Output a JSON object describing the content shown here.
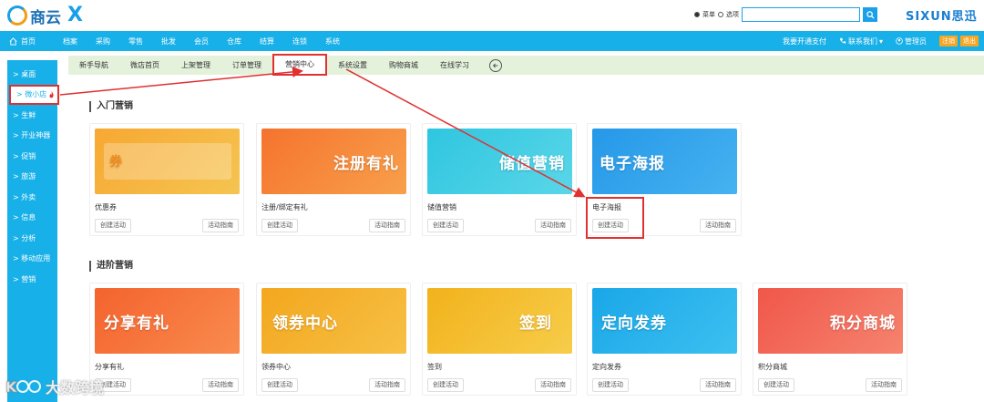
{
  "header": {
    "logo_text": "商云",
    "logo_x": "X",
    "brand": "SIXUN思迅",
    "search": {
      "option_menu": "菜单",
      "option_product": "选项",
      "value": ""
    }
  },
  "nav": {
    "items": [
      {
        "label": "首页",
        "icon": "home-icon"
      },
      {
        "label": "档案"
      },
      {
        "label": "采购"
      },
      {
        "label": "零售"
      },
      {
        "label": "批发"
      },
      {
        "label": "会员"
      },
      {
        "label": "仓库"
      },
      {
        "label": "结算"
      },
      {
        "label": "连锁"
      },
      {
        "label": "系统"
      }
    ],
    "right": {
      "pay": "我要开通支付",
      "contact": "联系我们",
      "admin": "管理员",
      "btn1": "注销",
      "btn2": "退出"
    }
  },
  "sidebar": {
    "items": [
      "> 桌面",
      "> 微小店",
      "> 生鲜",
      "> 开业神器",
      "> 促销",
      "> 旅游",
      "> 外卖",
      "> 信息",
      "> 分析",
      "> 移动应用",
      "> 营销"
    ]
  },
  "subnav": {
    "items": [
      "新手导航",
      "微店首页",
      "上架管理",
      "订单管理",
      "营销中心",
      "系统设置",
      "购物商城",
      "在线学习"
    ]
  },
  "sections": {
    "basic": "入门营销",
    "advanced": "进阶营销"
  },
  "cards": {
    "create": "创建活动",
    "guide": "活动指南",
    "basic": [
      {
        "name": "优惠券",
        "banner": "券",
        "color1": "#f7a832",
        "color2": "#f5c451"
      },
      {
        "name": "注册/绑定有礼",
        "banner": "注册有礼",
        "color1": "#f5732e",
        "color2": "#f8a04b"
      },
      {
        "name": "储值营销",
        "banner": "储值营销",
        "color1": "#2fc6e0",
        "color2": "#5ad6e8"
      },
      {
        "name": "电子海报",
        "banner": "电子海报",
        "color1": "#2598e8",
        "color2": "#46b2f0"
      }
    ],
    "advanced": [
      {
        "name": "分享有礼",
        "banner": "分享有礼",
        "color1": "#f4632e",
        "color2": "#f98b4e"
      },
      {
        "name": "领券中心",
        "banner": "领券中心",
        "color1": "#f3a71e",
        "color2": "#f7c045"
      },
      {
        "name": "签到",
        "banner": "签到",
        "color1": "#f2b21c",
        "color2": "#f7cd4a"
      },
      {
        "name": "定向发券",
        "banner": "定向发券",
        "color1": "#1aa7e8",
        "color2": "#3dc0f0"
      },
      {
        "name": "积分商城",
        "banner": "积分商城",
        "color1": "#f0574a",
        "color2": "#f6836f"
      }
    ]
  },
  "watermark": "大数跨境",
  "annotation_color": "#e03030"
}
